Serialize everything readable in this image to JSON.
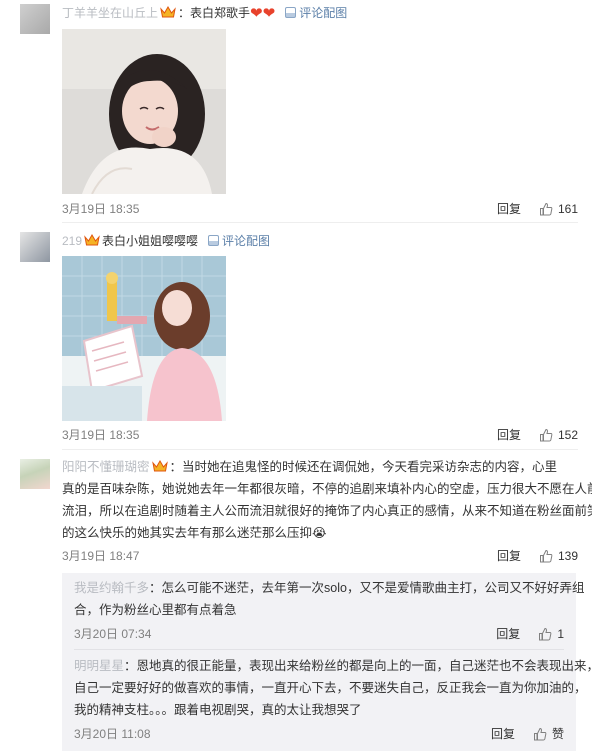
{
  "comments": [
    {
      "user": "丁羊羊坐在山丘上",
      "text": "：表白郑歌手",
      "hearts": [
        "❤",
        "❤"
      ],
      "pic_tag": "评论配图",
      "time": "3月19日 18:35",
      "reply": "回复",
      "likes": "161"
    },
    {
      "user": "219",
      "text": "表白小姐姐嘤嘤嘤",
      "pic_tag": "评论配图",
      "time": "3月19日 18:35",
      "reply": "回复",
      "likes": "152"
    },
    {
      "user": "阳阳不懂珊瑚密",
      "text_lines": [
        "：当时她在追鬼怪的时候还在调侃她，今天看完采访杂志的内容，心里",
        "真的是百味杂陈，她说她去年一年都很灰暗，不停的追剧来填补内心的空虚，压力很大不愿在人前",
        "流泪，所以在追剧时随着主人公而流泪就很好的掩饰了内心真正的感情，从来不知道在粉丝面前笑",
        "的这么快乐的她其实去年有那么迷茫那么压抑"
      ],
      "emoji": "😭",
      "time": "3月19日 18:47",
      "reply": "回复",
      "likes": "139"
    }
  ],
  "sub_comments": [
    {
      "user": "我是约翰千多",
      "text_lines": [
        "：怎么可能不迷茫，去年第一次solo，又不是爱情歌曲主打，公司又不好好弄组",
        "合，作为粉丝心里都有点着急"
      ],
      "time": "3月20日 07:34",
      "reply": "回复",
      "likes": "1"
    },
    {
      "user": "明明星星",
      "text_lines": [
        "：恩地真的很正能量，表现出来给粉丝的都是向上的一面，自己迷茫也不会表现出来，",
        "自己一定要好好的做喜欢的事情，一直开心下去，不要迷失自己，反正我会一直为你加油的，",
        "我的精神支柱。。。跟着电视剧哭，真的太让我想哭了"
      ],
      "time": "3月20日 11:08",
      "reply": "回复",
      "likes": "赞"
    }
  ]
}
